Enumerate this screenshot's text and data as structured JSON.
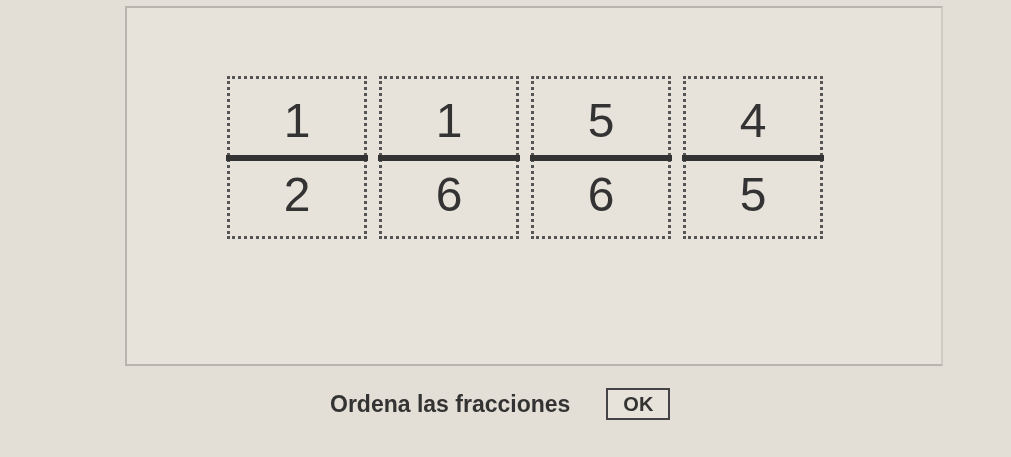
{
  "fractions": [
    {
      "numerator": "1",
      "denominator": "2"
    },
    {
      "numerator": "1",
      "denominator": "6"
    },
    {
      "numerator": "5",
      "denominator": "6"
    },
    {
      "numerator": "4",
      "denominator": "5"
    }
  ],
  "instruction": "Ordena las fracciones",
  "button": "OK"
}
